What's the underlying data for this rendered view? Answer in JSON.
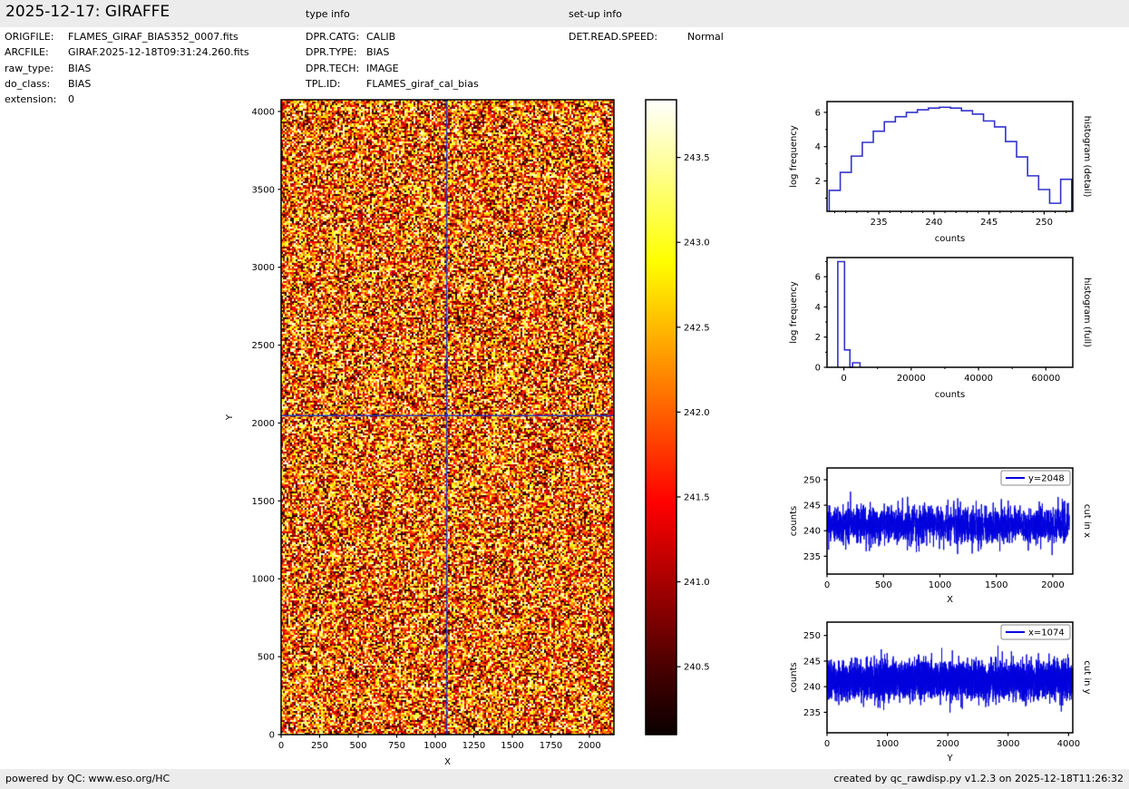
{
  "header": {
    "title": "2025-12-17: GIRAFFE",
    "type_info_label": "type info",
    "setup_info_label": "set-up info"
  },
  "file_info": {
    "rows": [
      {
        "label": "ORIGFILE:",
        "value": "FLAMES_GIRAF_BIAS352_0007.fits"
      },
      {
        "label": "ARCFILE:",
        "value": "GIRAF.2025-12-18T09:31:24.260.fits"
      },
      {
        "label": "raw_type:",
        "value": "BIAS"
      },
      {
        "label": "do_class:",
        "value": "BIAS"
      },
      {
        "label": "extension:",
        "value": "0"
      }
    ]
  },
  "type_info": {
    "rows": [
      {
        "label": "DPR.CATG:",
        "value": "CALIB"
      },
      {
        "label": "DPR.TYPE:",
        "value": "BIAS"
      },
      {
        "label": "DPR.TECH:",
        "value": "IMAGE"
      },
      {
        "label": "TPL.ID:",
        "value": "FLAMES_giraf_cal_bias"
      }
    ]
  },
  "setup_info": {
    "rows": [
      {
        "label": "DET.READ.SPEED:",
        "value": "Normal"
      }
    ]
  },
  "footer": {
    "left": "powered by QC: www.eso.org/HC",
    "right": "created by qc_rawdisp.py v1.2.3 on 2025-12-18T11:26:32"
  },
  "colors": {
    "bar_background": "#ececec",
    "axis": "#000000",
    "histogram_line": "#3333cc",
    "cut_line": "#0000dd",
    "crosshair": "#2233bb",
    "colormap": "hot (black-red-yellow-white)"
  },
  "chart_data": [
    {
      "id": "raw-image",
      "type": "heatmap",
      "description": "raw bias frame random noise image, hot colormap",
      "xlabel": "X",
      "ylabel": "Y",
      "xlim": [
        0,
        2159
      ],
      "ylim": [
        0,
        4075
      ],
      "x_ticks": [
        0,
        250,
        500,
        750,
        1000,
        1250,
        1500,
        1750,
        2000
      ],
      "y_ticks": [
        0,
        500,
        1000,
        1500,
        2000,
        2500,
        3000,
        3500,
        4000
      ],
      "value_range": [
        240.1,
        243.8
      ],
      "crosshair": {
        "x": 1074,
        "y": 2048
      }
    },
    {
      "id": "colorbar",
      "type": "colorbar",
      "range": [
        240.1,
        243.84
      ],
      "ticks": [
        {
          "v": 240.5,
          "l": "240.5"
        },
        {
          "v": 241.0,
          "l": "241.0"
        },
        {
          "v": 241.5,
          "l": "241.5"
        },
        {
          "v": 242.0,
          "l": "242.0"
        },
        {
          "v": 242.5,
          "l": "242.5"
        },
        {
          "v": 243.0,
          "l": "243.0"
        },
        {
          "v": 243.5,
          "l": "243.5"
        }
      ]
    },
    {
      "id": "histogram-detail",
      "type": "histogram",
      "right_label": "histogram (detail)",
      "xlabel": "counts",
      "ylabel": "log frequency",
      "bin_start": 230.5,
      "bin_width": 1,
      "values": [
        1.45,
        2.5,
        3.45,
        4.25,
        4.9,
        5.45,
        5.75,
        6.0,
        6.15,
        6.25,
        6.3,
        6.25,
        6.1,
        5.9,
        5.5,
        5.15,
        4.3,
        3.4,
        2.3,
        1.5,
        0.7,
        2.1
      ],
      "xlim": [
        230.3,
        252.6
      ],
      "ylim": [
        0.23,
        6.63
      ],
      "x_ticks": [
        235,
        240,
        245,
        250
      ],
      "x_minor_step": 1,
      "y_ticks": [
        2,
        4,
        6
      ],
      "y_minor": [
        1,
        3,
        5
      ]
    },
    {
      "id": "histogram-full",
      "type": "histogram",
      "right_label": "histogram (full)",
      "xlabel": "counts",
      "ylabel": "log frequency",
      "steps": [
        [
          -1800,
          7.0,
          200
        ],
        [
          200,
          1.15,
          1800
        ],
        [
          1800,
          0,
          2600
        ],
        [
          2600,
          0.3,
          4800
        ]
      ],
      "xlim": [
        -5000,
        68000
      ],
      "ylim": [
        0,
        7.27
      ],
      "x_ticks": [
        0,
        20000,
        40000,
        60000
      ],
      "x_minor": [
        10000,
        30000,
        50000
      ],
      "y_ticks": [
        0,
        2,
        4,
        6
      ],
      "y_minor": [
        1,
        3,
        5,
        7
      ]
    },
    {
      "id": "cut-in-x",
      "type": "line",
      "right_label": "cut in x",
      "xlabel": "X",
      "ylabel": "counts",
      "legend": "y=2048",
      "xlim": [
        0,
        2177
      ],
      "ylim": [
        231.5,
        252.3
      ],
      "x_ticks": [
        0,
        500,
        1000,
        1500,
        2000
      ],
      "y_ticks": [
        235,
        240,
        245,
        250
      ],
      "mean": 241.2,
      "noise_std": 1.85,
      "n_points": 2148
    },
    {
      "id": "cut-in-y",
      "type": "line",
      "right_label": "cut in y",
      "xlabel": "Y",
      "ylabel": "counts",
      "legend": "x=1074",
      "xlim": [
        0,
        4070
      ],
      "ylim": [
        231,
        252.6
      ],
      "x_ticks": [
        0,
        1000,
        2000,
        3000,
        4000
      ],
      "y_ticks": [
        235,
        240,
        245,
        250
      ],
      "mean": 241.3,
      "noise_std": 1.85,
      "n_points": 4096
    }
  ]
}
